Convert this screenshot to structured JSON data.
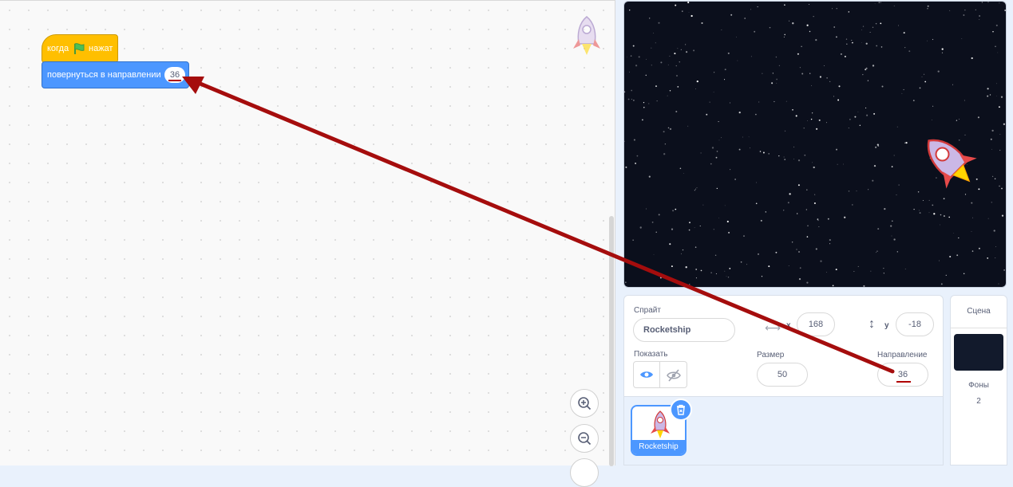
{
  "code": {
    "hat_when": "когда",
    "hat_clicked": "нажат",
    "motion_label": "повернуться в направлении",
    "motion_value": "36"
  },
  "sprite_info": {
    "sprite_label": "Спрайт",
    "sprite_name": "Rocketship",
    "x_label": "x",
    "x_value": "168",
    "y_label": "y",
    "y_value": "-18",
    "show_label": "Показать",
    "size_label": "Размер",
    "size_value": "50",
    "direction_label": "Направление",
    "direction_value": "36"
  },
  "sprite_list": {
    "items": [
      {
        "name": "Rocketship",
        "selected": true
      }
    ]
  },
  "stage_pane": {
    "title": "Сцена",
    "backdrops_label": "Фоны",
    "backdrops_count": "2"
  },
  "colors": {
    "events": "#ffbf00",
    "motion": "#4c97ff",
    "annotation_arrow": "#a50d0d"
  },
  "icons": [
    "green-flag-icon",
    "zoom-in-icon",
    "zoom-out-icon",
    "eye-icon",
    "eye-slash-icon",
    "trash-icon",
    "arrows-horizontal-icon",
    "arrows-vertical-icon"
  ]
}
